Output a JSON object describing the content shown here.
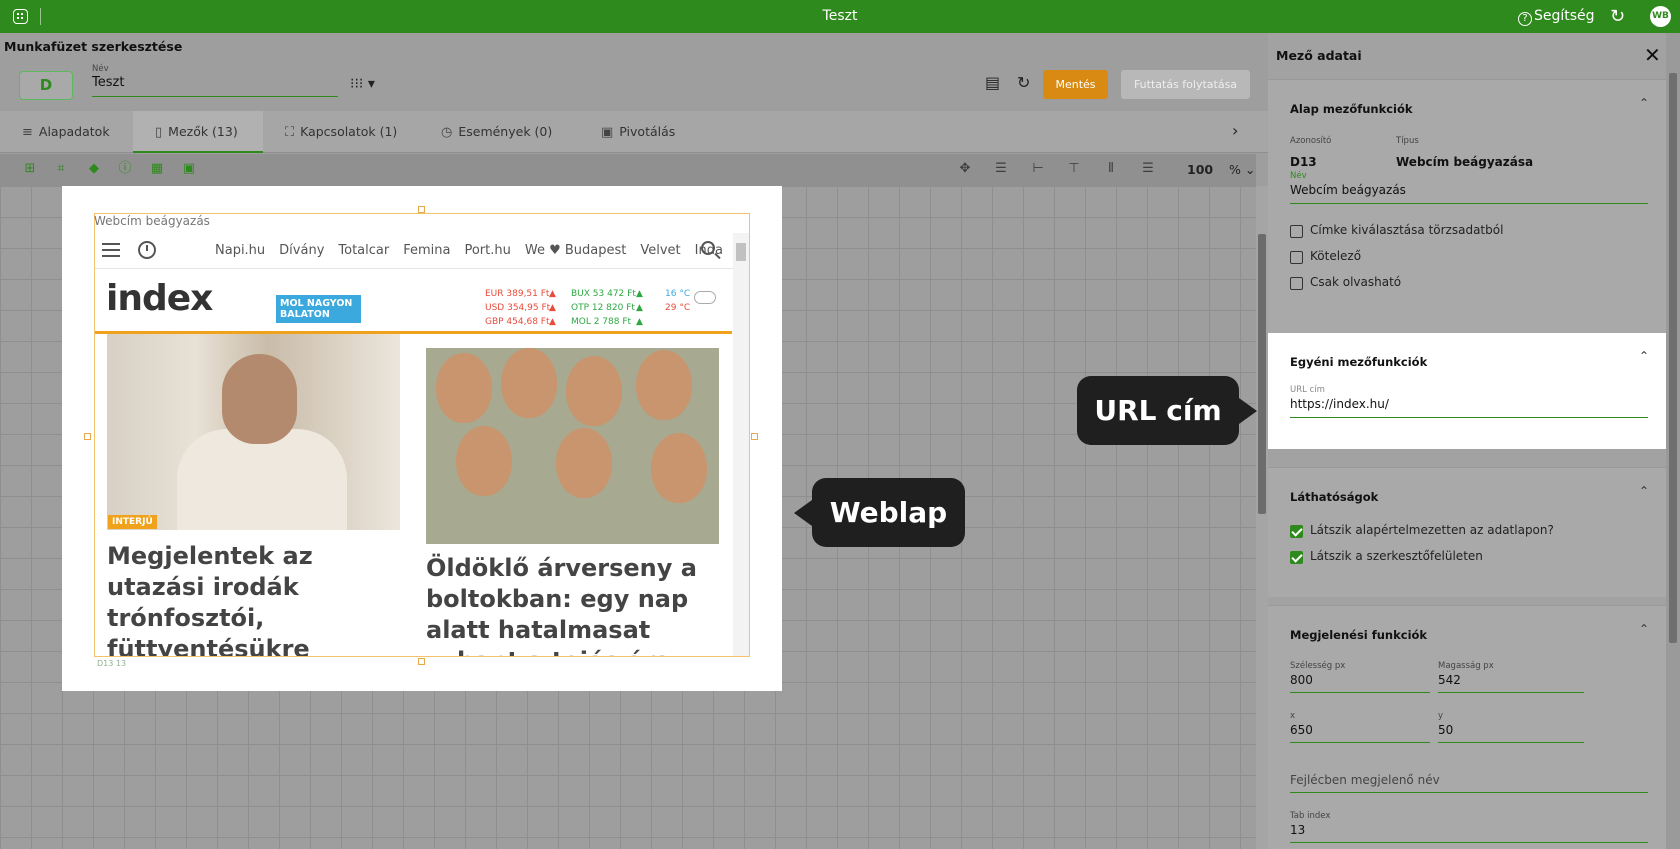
{
  "topbar": {
    "title": "Teszt",
    "help": "Segítség",
    "avatar": "WB"
  },
  "editor": {
    "title": "Munkafüzet szerkesztése",
    "d_button": "D",
    "name_label": "Név",
    "name_value": "Teszt",
    "save": "Mentés",
    "continue": "Futtatás folytatása"
  },
  "tabs": [
    {
      "label": "Alapadatok",
      "icon": "database-icon"
    },
    {
      "label": "Mezők (13)",
      "icon": "fields-icon"
    },
    {
      "label": "Kapcsolatok (1)",
      "icon": "relations-icon"
    },
    {
      "label": "Események (0)",
      "icon": "events-icon"
    },
    {
      "label": "Pivotálás",
      "icon": "pivot-icon"
    }
  ],
  "toolbar": {
    "zoom": "100",
    "zoom_unit": "%"
  },
  "canvas": {
    "field_label": "Webcím beágyazás",
    "field_id": "D13",
    "field_index": "13",
    "site": {
      "nav": [
        "Napi.hu",
        "Dívány",
        "Totalcar",
        "Femina",
        "Port.hu",
        "We ♥ Budapest",
        "Velvet",
        "Inda"
      ],
      "logo": "index",
      "promo": "MOL NAGYON BALATON",
      "fx_left": [
        "EUR 389,51 Ft",
        "USD 354,95 Ft",
        "GBP 454,68 Ft"
      ],
      "fx_right": [
        "BUX 53 472 Ft",
        "OTP 12 820 Ft",
        "MOL 2 788 Ft"
      ],
      "temp_high": "16 °C",
      "temp_low": "29 °C",
      "badge": "INTERJÚ",
      "headline1": "Megjelentek az utazási irodák trónfosztói, füttyentésükre záporoznak a forintok",
      "headline2": "Öldöklő árverseny a boltokban: egy nap alatt hatalmasat zuhant a tojás ára"
    }
  },
  "callouts": {
    "web": "Weblap",
    "url": "URL cím"
  },
  "panel": {
    "title": "Mező adatai",
    "sec1": {
      "title": "Alap mezőfunkciók",
      "id_label": "Azonosító",
      "id_value": "D13",
      "type_label": "Típus",
      "type_value": "Webcím beágyazása",
      "name_label": "Név",
      "name_value": "Webcím beágyazás",
      "checks": [
        {
          "label": "Címke kiválasztása törzsadatból",
          "checked": false
        },
        {
          "label": "Kötelező",
          "checked": false
        },
        {
          "label": "Csak olvasható",
          "checked": false
        }
      ]
    },
    "sec2": {
      "title": "Egyéni mezőfunkciók",
      "url_label": "URL cím",
      "url_value": "https://index.hu/"
    },
    "sec3": {
      "title": "Láthatóságok",
      "checks": [
        {
          "label": "Látszik alapértelmezetten az adatlapon?",
          "checked": true
        },
        {
          "label": "Látszik a szerkesztőfelületen",
          "checked": true
        }
      ]
    },
    "sec4": {
      "title": "Megjelenési funkciók",
      "width_label": "Szélesség px",
      "width_value": "800",
      "height_label": "Magasság px",
      "height_value": "542",
      "x_label": "x",
      "x_value": "650",
      "y_label": "y",
      "y_value": "50",
      "header_name_placeholder": "Fejlécben megjelenő név",
      "tab_index_label": "Tab index",
      "tab_index_value": "13"
    }
  }
}
